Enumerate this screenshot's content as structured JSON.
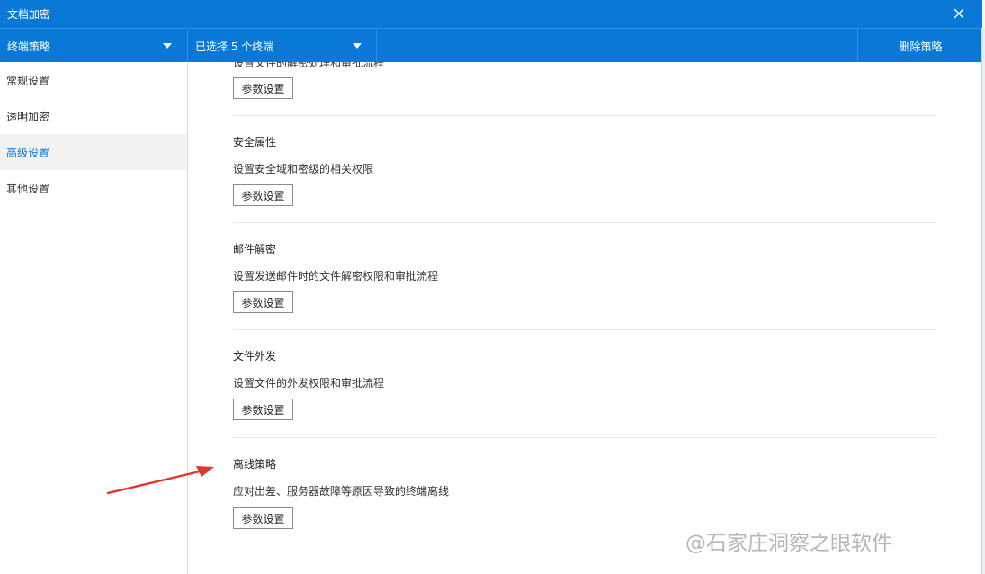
{
  "window": {
    "title": "文档加密",
    "close_icon": "close-icon"
  },
  "toolbar": {
    "policy_dropdown": "终端策略",
    "terminal_dropdown": "已选择 5 个终端",
    "delete_label": "删除策略"
  },
  "sidebar": {
    "items": [
      {
        "label": "常规设置",
        "active": false
      },
      {
        "label": "透明加密",
        "active": false
      },
      {
        "label": "高级设置",
        "active": true
      },
      {
        "label": "其他设置",
        "active": false
      }
    ]
  },
  "main": {
    "partial_desc": "设置文件的解密处理和审批流程",
    "sections": [
      {
        "title": "安全属性",
        "desc": "设置安全域和密级的相关权限",
        "button": "参数设置"
      },
      {
        "title": "邮件解密",
        "desc": "设置发送邮件时的文件解密权限和审批流程",
        "button": "参数设置"
      },
      {
        "title": "文件外发",
        "desc": "设置文件的外发权限和审批流程",
        "button": "参数设置"
      },
      {
        "title": "离线策略",
        "desc": "应对出差、服务器故障等原因导致的终端离线",
        "button": "参数设置"
      }
    ],
    "top_button": "参数设置"
  },
  "watermark": "@石家庄洞察之眼软件",
  "colors": {
    "accent": "#0a78d7",
    "arrow": "#e0362c"
  }
}
